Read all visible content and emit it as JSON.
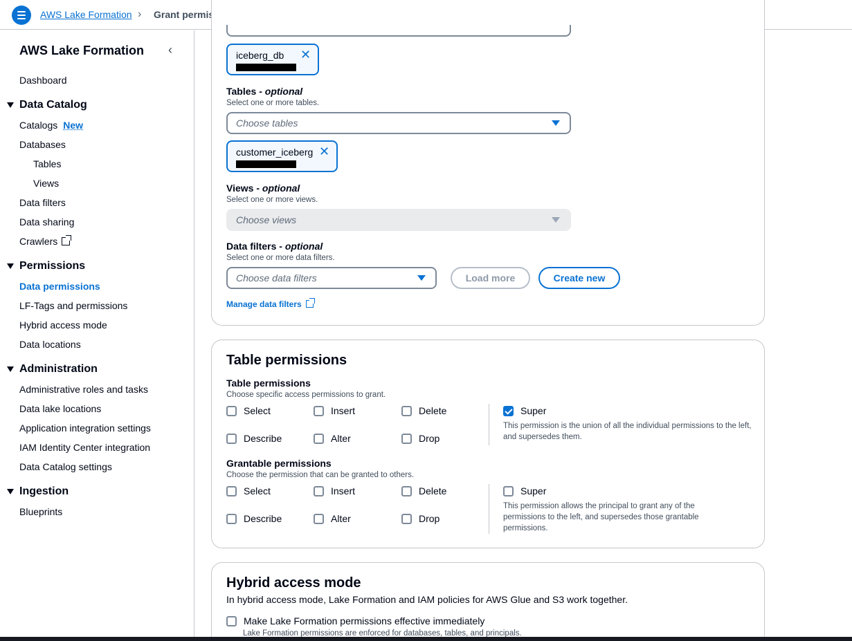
{
  "breadcrumb": {
    "root": "AWS Lake Formation",
    "current": "Grant permissions"
  },
  "sidebar": {
    "title": "AWS Lake Formation",
    "dashboard": "Dashboard",
    "sections": {
      "data_catalog": "Data Catalog",
      "permissions": "Permissions",
      "administration": "Administration",
      "ingestion": "Ingestion"
    },
    "items": {
      "catalogs": "Catalogs",
      "catalogs_badge": "New",
      "databases": "Databases",
      "tables": "Tables",
      "views": "Views",
      "data_filters": "Data filters",
      "data_sharing": "Data sharing",
      "crawlers": "Crawlers",
      "data_permissions": "Data permissions",
      "lf_tags": "LF-Tags and permissions",
      "hybrid_access": "Hybrid access mode",
      "data_locations": "Data locations",
      "admin_roles": "Administrative roles and tasks",
      "data_lake_locations": "Data lake locations",
      "app_integration": "Application integration settings",
      "iam_identity": "IAM Identity Center integration",
      "catalog_settings": "Data Catalog settings",
      "blueprints": "Blueprints"
    }
  },
  "resources": {
    "database_token": "iceberg_db",
    "tables": {
      "label": "Tables",
      "optional": "optional",
      "description": "Select one or more tables.",
      "placeholder": "Choose tables",
      "token": "customer_iceberg"
    },
    "views": {
      "label": "Views",
      "optional": "optional",
      "description": "Select one or more views.",
      "placeholder": "Choose views"
    },
    "data_filters": {
      "label": "Data filters",
      "optional": "optional",
      "description": "Select one or more data filters.",
      "placeholder": "Choose data filters",
      "load_more": "Load more",
      "create_new": "Create new",
      "manage_link": "Manage data filters"
    }
  },
  "table_permissions": {
    "title": "Table permissions",
    "perm_label": "Table permissions",
    "perm_desc": "Choose specific access permissions to grant.",
    "grant_label": "Grantable permissions",
    "grant_desc": "Choose the permission that can be granted to others.",
    "options": {
      "select": "Select",
      "insert": "Insert",
      "delete": "Delete",
      "describe": "Describe",
      "alter": "Alter",
      "drop": "Drop",
      "super": "Super"
    },
    "super_checked": true,
    "super_help": "This permission is the union of all the individual permissions to the left, and supersedes them.",
    "grant_super_help": "This permission allows the principal to grant any of the permissions to the left, and supersedes those grantable permissions."
  },
  "hybrid": {
    "title": "Hybrid access mode",
    "description": "In hybrid access mode, Lake Formation and IAM policies for AWS Glue and S3 work together.",
    "checkbox_label": "Make Lake Formation permissions effective immediately",
    "checkbox_help": "Lake Formation permissions are enforced for databases, tables, and principals."
  },
  "colors": {
    "accent": "#0972d3",
    "text": "#000716",
    "border": "#c6c6cd"
  }
}
